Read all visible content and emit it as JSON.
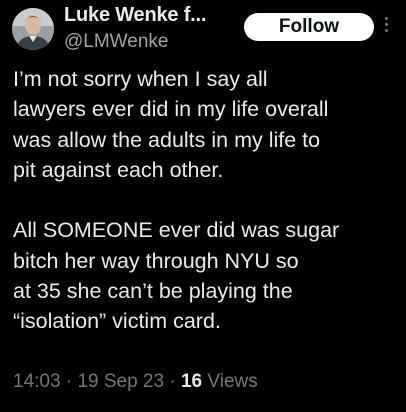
{
  "author": {
    "display_name": "Luke Wenke f...",
    "handle": "@LMWenke"
  },
  "follow_label": "Follow",
  "body": {
    "paragraph_1": [
      "I’m not sorry when I say all",
      "lawyers ever did in my life overall",
      "was allow the adults in my life to",
      "pit against each other."
    ],
    "paragraph_2": [
      "All SOMEONE ever did was sugar",
      "bitch her way through NYU so",
      "at 35 she can’t be playing the",
      "“isolation” victim card."
    ]
  },
  "meta": {
    "time": "14:03",
    "separator_1": " · ",
    "date": "19 Sep 23",
    "separator_2": " · ",
    "views_count": "16",
    "views_label": " Views"
  },
  "colors": {
    "background": "#000000",
    "text": "#e7e9ea",
    "secondary_text": "#71767b",
    "follow_button_bg": "#ffffff"
  },
  "icons": {
    "more": "vertical-ellipsis-icon"
  }
}
